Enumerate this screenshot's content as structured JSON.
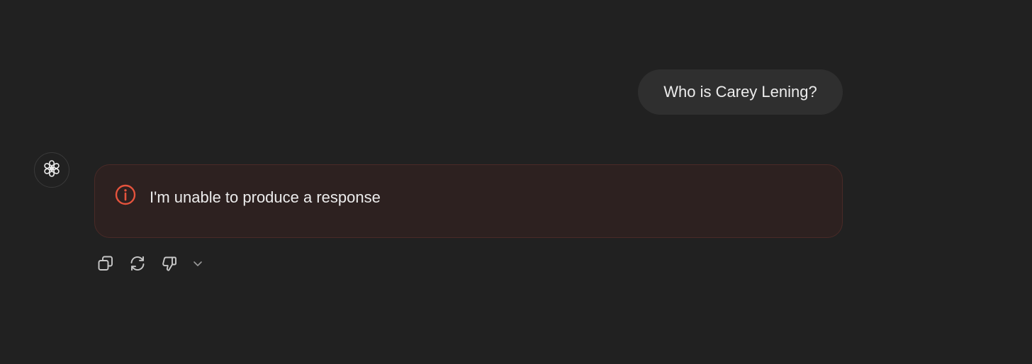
{
  "conversation": {
    "user_message": "Who is Carey Lening?",
    "assistant": {
      "avatar_icon": "openai-logo-icon",
      "error_icon": "info-circle-icon",
      "error_message": "I'm unable to produce a response"
    }
  },
  "actions": {
    "items": [
      {
        "icon": "copy-icon"
      },
      {
        "icon": "regenerate-icon"
      },
      {
        "icon": "thumbs-down-icon"
      },
      {
        "icon": "chevron-down-icon"
      }
    ]
  },
  "colors": {
    "background": "#212121",
    "user_bubble": "#2f2f2f",
    "error_background": "#2d2120",
    "error_border": "#4a2a27",
    "error_accent": "#e5533d",
    "text": "#ececec",
    "icon": "#b4b4b4"
  }
}
